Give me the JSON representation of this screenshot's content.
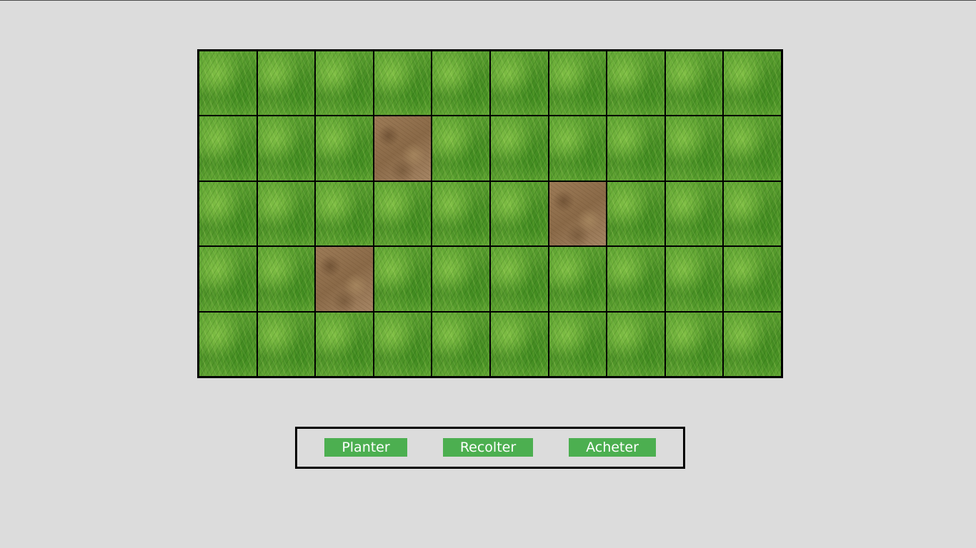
{
  "field": {
    "rows": 5,
    "cols": 10,
    "tiles": [
      [
        "grass",
        "grass",
        "grass",
        "grass",
        "grass",
        "grass",
        "grass",
        "grass",
        "grass",
        "grass"
      ],
      [
        "grass",
        "grass",
        "grass",
        "soil",
        "grass",
        "grass",
        "grass",
        "grass",
        "grass",
        "grass"
      ],
      [
        "grass",
        "grass",
        "grass",
        "grass",
        "grass",
        "grass",
        "soil",
        "grass",
        "grass",
        "grass"
      ],
      [
        "grass",
        "grass",
        "soil",
        "grass",
        "grass",
        "grass",
        "grass",
        "grass",
        "grass",
        "grass"
      ],
      [
        "grass",
        "grass",
        "grass",
        "grass",
        "grass",
        "grass",
        "grass",
        "grass",
        "grass",
        "grass"
      ]
    ]
  },
  "actions": {
    "plant_label": "Planter",
    "harvest_label": "Recolter",
    "buy_label": "Acheter"
  },
  "colors": {
    "background": "#dcdcdc",
    "button": "#4caf50",
    "button_text": "#ffffff",
    "border": "#000000"
  }
}
